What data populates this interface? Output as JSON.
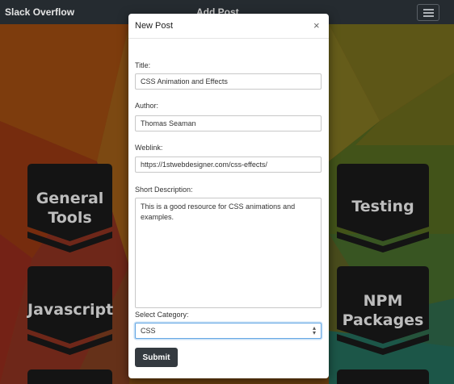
{
  "navbar": {
    "brand": "Slack Overflow",
    "center_title": "Add Post",
    "menu_icon": "hamburger-icon"
  },
  "categories": [
    {
      "label": "General Tools",
      "lines": [
        "General",
        "Tools"
      ]
    },
    {
      "label": "Testing",
      "lines": [
        "Testing"
      ]
    },
    {
      "label": "Javascript",
      "lines": [
        "Javascript"
      ]
    },
    {
      "label": "NPM Packages",
      "lines": [
        "NPM",
        "Packages"
      ]
    }
  ],
  "modal": {
    "title": "New Post",
    "close_icon": "close-icon",
    "close_glyph": "×",
    "fields": {
      "title_label": "Title:",
      "title_value": "CSS Animation and Effects",
      "author_label": "Author:",
      "author_value": "Thomas Seaman",
      "weblink_label": "Weblink:",
      "weblink_value": "https://1stwebdesigner.com/css-effects/",
      "description_label": "Short Description:",
      "description_value": "This is a good resource for CSS animations and examples.",
      "category_label": "Select Category:",
      "category_value": "CSS"
    },
    "submit_label": "Submit"
  },
  "colors": {
    "navbar": "#252b30",
    "badge": "#141414",
    "badge_text": "#bdbdbd",
    "submit": "#343a40",
    "select_focus": "#66a8e4"
  }
}
